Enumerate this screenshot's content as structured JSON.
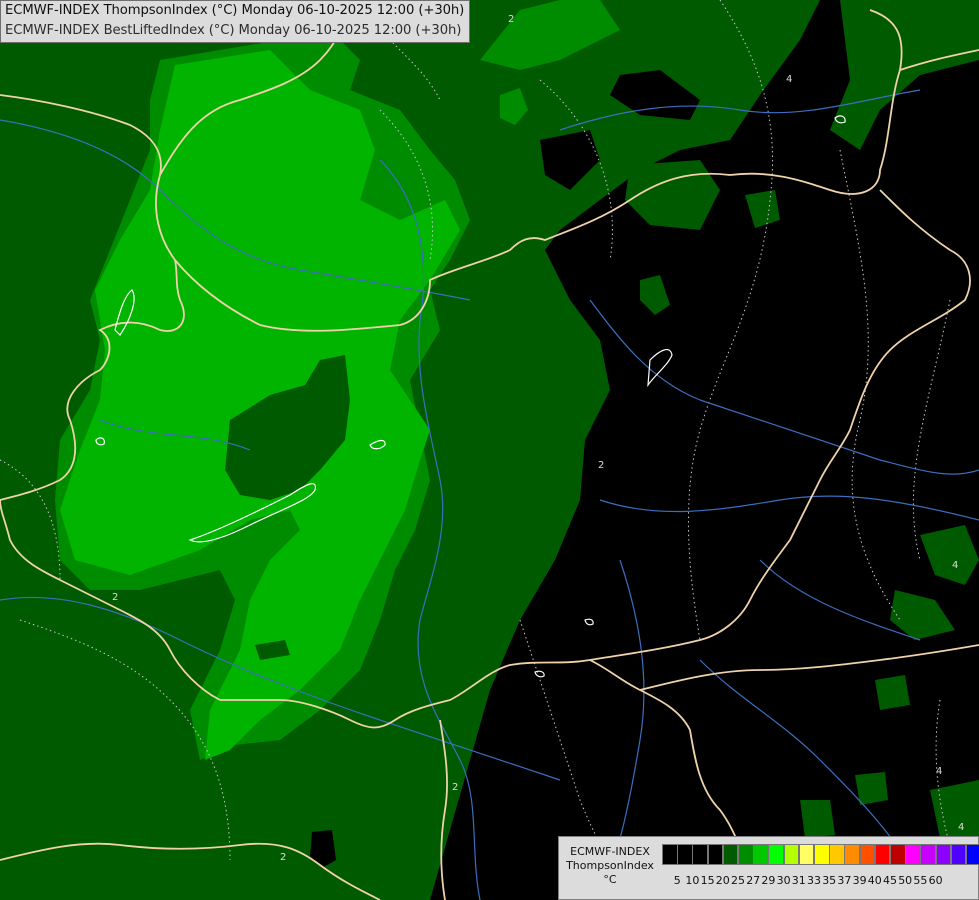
{
  "header": {
    "line1": "ECMWF-INDEX ThompsonIndex (°C) Monday 06-10-2025 12:00 (+30h)",
    "line2": "ECMWF-INDEX BestLiftedIndex (°C) Monday 06-10-2025 12:00 (+30h)"
  },
  "legend": {
    "caption": [
      "ECMWF-INDEX",
      "ThompsonIndex",
      "°C"
    ],
    "labels": [
      "5",
      "10",
      "15",
      "20",
      "25",
      "27",
      "29",
      "30",
      "31",
      "33",
      "35",
      "37",
      "39",
      "40",
      "45",
      "50",
      "55",
      "60"
    ],
    "colors": [
      "#000000",
      "#000000",
      "#000000",
      "#000000",
      "#005a00",
      "#008c00",
      "#00c800",
      "#00ff00",
      "#b4ff00",
      "#ffff64",
      "#ffff00",
      "#ffc800",
      "#ff8c00",
      "#ff5000",
      "#ff0000",
      "#be0000",
      "#ff00ff",
      "#c800ff",
      "#8c00ff",
      "#5000ff",
      "#0000ff"
    ]
  },
  "map_colors": {
    "background": "#000000",
    "dark_green": "#005a00",
    "medium_green": "#008c00",
    "bright_green": "#00b400",
    "borders": "#f0d2aa",
    "rivers": "#3c6ebe",
    "contours": "#c8c8c8"
  },
  "contour_labels": [
    "2",
    "2",
    "2",
    "2",
    "2",
    "4",
    "4",
    "4",
    "4"
  ]
}
